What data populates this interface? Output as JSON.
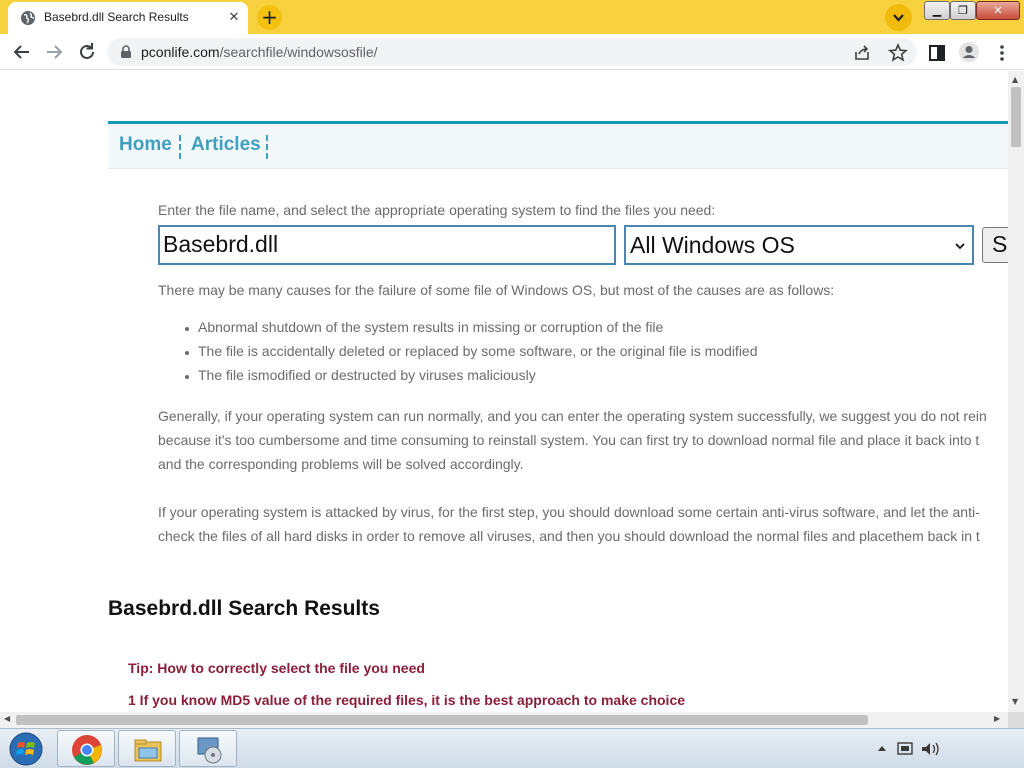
{
  "browser": {
    "tab_title": "Basebrd.dll Search Results",
    "url_host": "pconlife.com",
    "url_path": "/searchfile/windowsosfile/"
  },
  "site": {
    "nav": {
      "home": "Home",
      "articles": "Articles"
    },
    "search": {
      "prompt": "Enter the file name, and select the appropriate operating system to find the files you need:",
      "file_value": "Basebrd.dll",
      "os_selected": "All Windows OS",
      "button_label": "S"
    },
    "causes_intro": "There may be many causes for the failure of some file of Windows OS, but most of the causes are as follows:",
    "causes": [
      "Abnormal shutdown of the system results in missing or corruption of the file",
      "The file is accidentally deleted or replaced by some software, or the original file is modified",
      "The file ismodified or destructed by viruses maliciously"
    ],
    "para1": {
      "line1": "Generally, if your operating system can run normally, and you can enter the operating system successfully, we suggest you do not rein",
      "line2": "because it's too cumbersome and time consuming to reinstall system. You can first try to download normal file and place it back into t",
      "line3": "and the corresponding problems will be solved accordingly."
    },
    "para2": {
      "line1": "If your operating system is attacked by virus, for the first step, you should download some certain anti-virus software, and let the anti-",
      "line2": "check the files of all hard disks in order to remove all viruses, and then you should download the normal files and placethem back in t"
    },
    "results_title": "Basebrd.dll Search Results",
    "tip_title": "Tip: How to correctly select the file you need",
    "tip_1": "1 If you know MD5 value of the required files, it is the best approach to make choice"
  },
  "colors": {
    "titlebar": "#f7d23e",
    "nav_accent": "#1699b4",
    "nav_link": "#3f9fc0",
    "tip": "#8b1f3a"
  },
  "icons": {
    "tab": "globe-icon",
    "taskbar": [
      "windows-start-icon",
      "chrome-icon",
      "file-explorer-icon",
      "media-player-icon"
    ],
    "tray": [
      "tray-arrow-icon",
      "network-icon",
      "volume-icon"
    ]
  }
}
